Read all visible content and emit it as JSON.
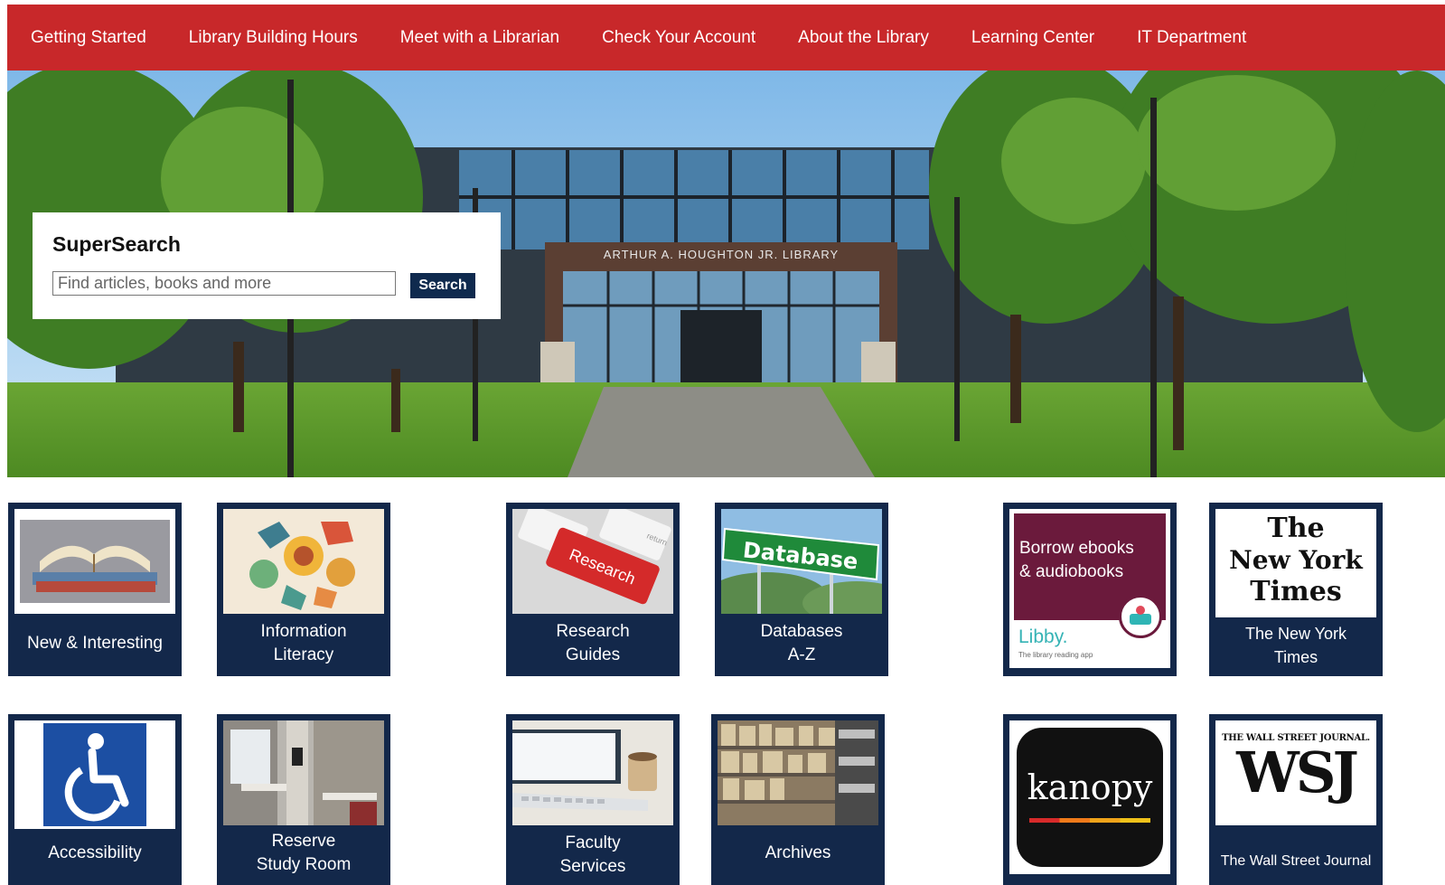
{
  "nav": {
    "items": [
      "Getting Started",
      "Library Building Hours",
      "Meet with a Librarian",
      "Check Your Account",
      "About the Library",
      "Learning Center",
      "IT Department"
    ]
  },
  "hero": {
    "sign_text": "ARTHUR A. HOUGHTON JR. LIBRARY"
  },
  "supersearch": {
    "title": "SuperSearch",
    "placeholder": "Find articles, books and more",
    "button_label": "Search"
  },
  "tiles": {
    "new_interesting": {
      "label": "New & Interesting"
    },
    "info_literacy": {
      "label1": "Information",
      "label2": "Literacy"
    },
    "research_guides": {
      "label1": "Research",
      "label2": "Guides",
      "image_text": "Research",
      "image_key": "return"
    },
    "databases": {
      "label1": "Databases",
      "label2": "A-Z",
      "image_text": "Database"
    },
    "libby": {
      "image_text1": "Borrow ebooks",
      "image_text2": "& audiobooks",
      "brand": "Libby.",
      "tagline": "The library reading app"
    },
    "nyt": {
      "logo1": "The",
      "logo2": "New York",
      "logo3": "Times",
      "label1": "The New York",
      "label2": "Times"
    },
    "accessibility": {
      "label": "Accessibility"
    },
    "reserve_room": {
      "label1": "Reserve",
      "label2": "Study Room"
    },
    "faculty": {
      "label1": "Faculty",
      "label2": "Services"
    },
    "archives": {
      "label": "Archives"
    },
    "kanopy": {
      "logo": "kanopy"
    },
    "wsj": {
      "masthead": "THE WALL STREET JOURNAL.",
      "logo": "WSJ",
      "label": "The Wall Street Journal"
    }
  },
  "colors": {
    "nav_bg": "#c8282a",
    "tile_bg": "#13284a",
    "button_bg": "#0f2a4e"
  }
}
